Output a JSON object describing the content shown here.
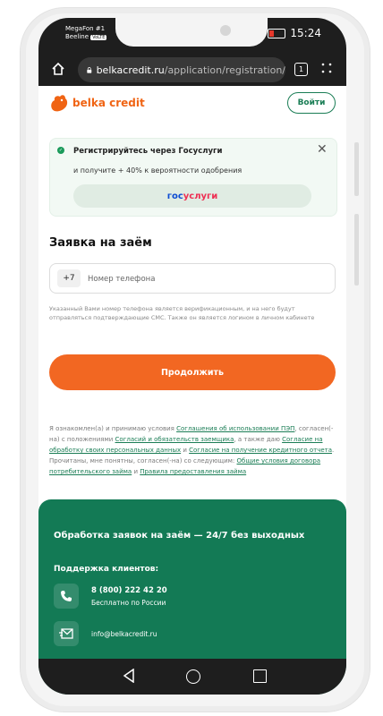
{
  "status": {
    "carrier1": "MegaFon #1",
    "carrier2": "Beeline",
    "volte": "VoLTE",
    "time": "15:24",
    "battery_color": "#e5382b"
  },
  "browser": {
    "url_host": "belkacredit.ru",
    "url_path": "/application/registration/",
    "tabs_count": "1"
  },
  "header": {
    "logo_text": "belka credit",
    "login_label": "Войти",
    "brand_color": "#f06414"
  },
  "gosuslugi": {
    "title": "Регистрируйтесь через Госуслуги",
    "subtitle": "и получите + 40% к вероятности одобрения",
    "button_part1": "гос",
    "button_part2": "услуги"
  },
  "form": {
    "title": "Заявка на заём",
    "phone_prefix": "+7",
    "phone_placeholder": "Номер телефона",
    "hint": "Указанный Вами номер телефона является верификационным, и на него будут отправляться подтверждающие СМС. Также он является логином в личном кабинете",
    "continue_label": "Продолжить"
  },
  "consent": {
    "t1": "Я ознакомлен(а) и принимаю условия ",
    "l1": "Соглашения об использовании ПЭП",
    "t2": ", согласен(-на) с положениями ",
    "l2": "Согласий и обязательств заемщика",
    "t3": ", а также даю ",
    "l3": "Согласие на обработку своих персональных данных",
    "t4": " и ",
    "l4": "Согласие на получение кредитного отчета",
    "t5": ". Прочитаны, мне понятны, согласен(-на) со следующим: ",
    "l5": "Общие условия договора потребительского займа",
    "t6": " и ",
    "l6": "Правила предоставления займа"
  },
  "footer": {
    "title": "Обработка заявок на заём — 24/7 без выходных",
    "support_label": "Поддержка клиентов:",
    "phone": "8 (800) 222 42 20",
    "phone_sub": "Бесплатно по России",
    "email": "info@belkacredit.ru",
    "bg_color": "#137a55"
  },
  "accent": {
    "orange": "#f26722",
    "green": "#1a7d55"
  }
}
